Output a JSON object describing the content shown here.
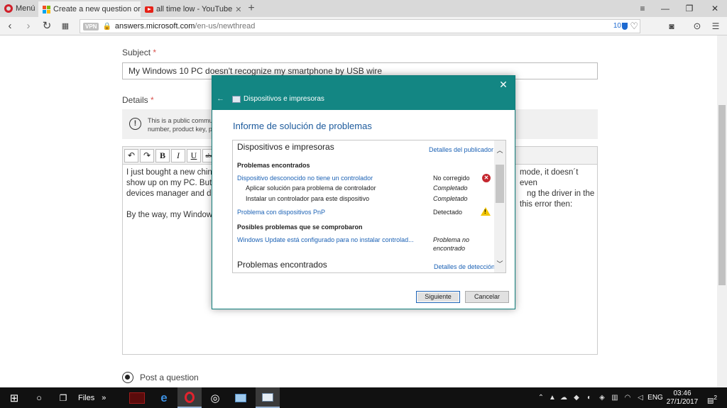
{
  "browser": {
    "menu_label": "Menú",
    "tabs": [
      {
        "title": "Create a new question or s",
        "active": true
      },
      {
        "title": "all time low - YouTube",
        "active": false
      }
    ],
    "new_tab": "+",
    "url_vpn": "VPN",
    "url_host": "answers.microsoft.com",
    "url_path": "/en-us/newthread",
    "adblock_count": "10"
  },
  "form": {
    "subject_label": "Subject",
    "required_mark": "*",
    "subject_value": "My Windows 10 PC doesn't recognize my smartphone by USB wire",
    "details_label": "Details",
    "notice_line1": "This is a public commu",
    "notice_line2": "number, product key, p",
    "toolbar": {
      "undo": "↶",
      "redo": "↷",
      "bold": "B",
      "italic": "I",
      "underline": "U",
      "strike": "abc"
    },
    "body_left": [
      "I just bought a new chine",
      "show up on my PC. But if",
      "devices manager and dev",
      "",
      "By the way, my Windows"
    ],
    "body_right": [
      "mode, it doesn´t even",
      "ng the driver in the",
      "this error then:"
    ],
    "post_option": "Post a question"
  },
  "dialog": {
    "window_title": "Dispositivos e impresoras",
    "heading": "Informe de solución de problemas",
    "section_title": "Dispositivos e impresoras",
    "publisher_link": "Detalles del publicador",
    "problems_found_label": "Problemas encontrados",
    "rows": [
      {
        "name": "Dispositivo desconocido no tiene un controlador",
        "status": "No corregido",
        "link": true
      },
      {
        "name": "Aplicar solución para problema de controlador",
        "status": "Completado",
        "link": false
      },
      {
        "name": "Instalar un controlador para este dispositivo",
        "status": "Completado",
        "link": false
      },
      {
        "name": "Problema con dispositivos PnP",
        "status": "Detectado",
        "link": true
      }
    ],
    "checked_label": "Posibles problemas que se comprobaron",
    "checked_row": {
      "name": "Windows Update está configurado para no instalar controlad...",
      "status_line1": "Problema no",
      "status_line2": "encontrado"
    },
    "section2_title": "Problemas encontrados",
    "detection_link": "Detalles de detección",
    "next_button": "Siguiente",
    "cancel_button": "Cancelar"
  },
  "taskbar": {
    "files_label": "Files",
    "files_more": "»",
    "language": "ENG",
    "time": "03:46",
    "date": "27/1/2017",
    "notifications": "2"
  },
  "colors": {
    "dialog_header": "#138683",
    "link_blue": "#1c62b5",
    "heading_blue": "#1c5a9c",
    "error_red": "#c4262e",
    "warning_yellow": "#f2c500",
    "taskbar": "#111111"
  }
}
